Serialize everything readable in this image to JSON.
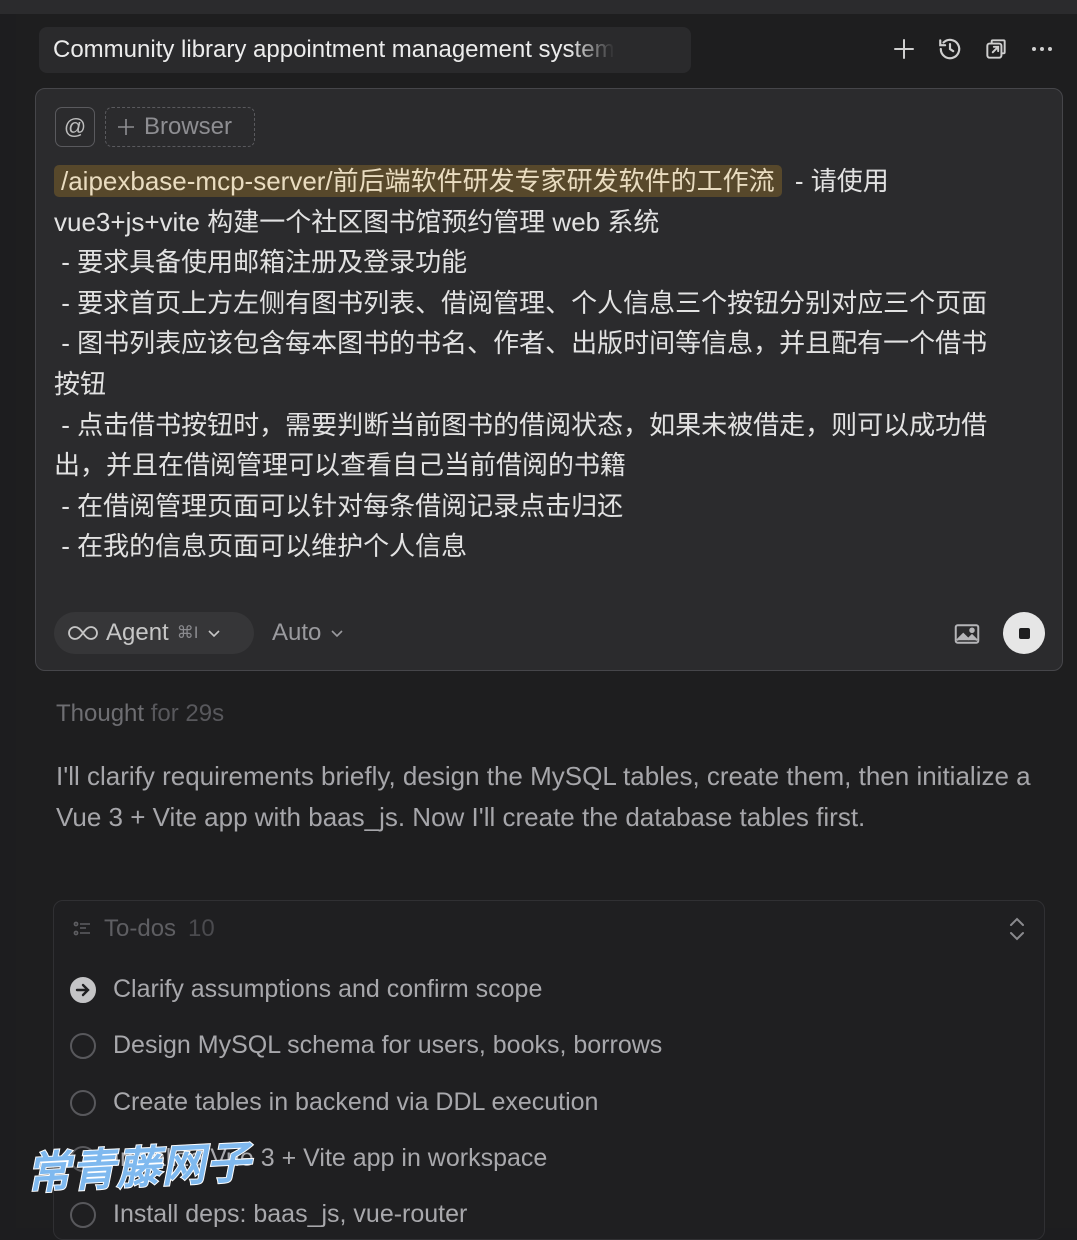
{
  "header": {
    "title": "Community library appointment management system"
  },
  "composer": {
    "at_label": "@",
    "browser_chip": "Browser",
    "mention": "/aipexbase-mcp-server/前后端软件研发专家研发软件的工作流",
    "prompt_lines": [
      "- 请使用",
      "vue3+js+vite 构建一个社区图书馆预约管理 web 系统",
      " - 要求具备使用邮箱注册及登录功能",
      " - 要求首页上方左侧有图书列表、借阅管理、个人信息三个按钮分别对应三个页面",
      " - 图书列表应该包含每本图书的书名、作者、出版时间等信息，并且配有一个借书",
      "按钮",
      " - 点击借书按钮时，需要判断当前图书的借阅状态，如果未被借走，则可以成功借",
      "出，并且在借阅管理可以查看自己当前借阅的书籍",
      " - 在借阅管理页面可以针对每条借阅记录点击归还",
      " - 在我的信息页面可以维护个人信息"
    ],
    "mode_label": "Agent",
    "mode_shortcut": "⌘I",
    "model_label": "Auto"
  },
  "thought": {
    "label": "Thought",
    "duration": "for 29s"
  },
  "response": "I'll clarify requirements briefly, design the MySQL tables, create them, then initialize a Vue 3 + Vite app with baas_js. Now I'll create the database tables first.",
  "todos": {
    "label": "To-dos",
    "count": "10",
    "items": [
      {
        "label": "Clarify assumptions and confirm scope",
        "status": "in_progress"
      },
      {
        "label": "Design MySQL schema for users, books, borrows",
        "status": "pending"
      },
      {
        "label": "Create tables in backend via DDL execution",
        "status": "pending"
      },
      {
        "label": "Initialize Vue 3 + Vite app in workspace",
        "status": "pending"
      },
      {
        "label": "Install deps: baas_js, vue-router",
        "status": "pending"
      }
    ]
  },
  "watermark": "常青藤网子",
  "icons": {
    "new": "plus-icon",
    "history": "history-icon",
    "open": "open-external-icon",
    "more": "more-icon",
    "image": "image-icon",
    "stop": "stop-icon",
    "agent": "infinity-icon"
  }
}
